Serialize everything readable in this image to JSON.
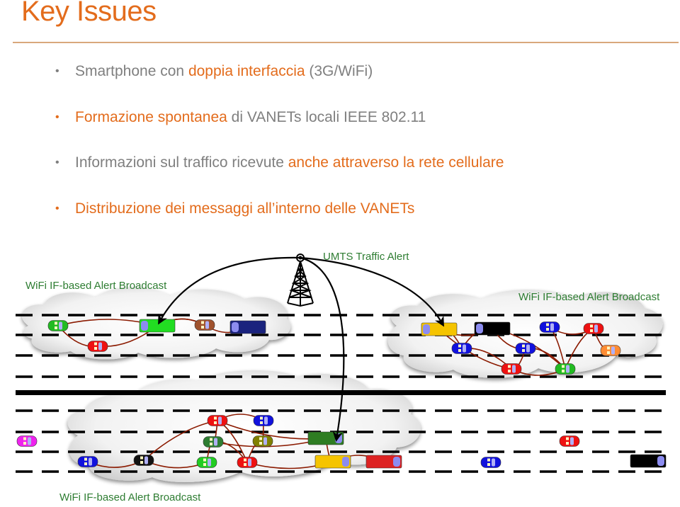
{
  "slide": {
    "title": "Key Issues",
    "accent_color": "#E36C1C",
    "text_color": "#7F7F7F",
    "bullets": [
      {
        "marker": "•",
        "marker_color": "gray",
        "parts": [
          {
            "text": "Smartphone con ",
            "highlight": false
          },
          {
            "text": "doppia interfaccia",
            "highlight": true
          },
          {
            "text": " (3G/WiFi)",
            "highlight": false
          }
        ]
      },
      {
        "marker": "•",
        "marker_color": "orange",
        "parts": [
          {
            "text": "Formazione spontanea",
            "highlight": true
          },
          {
            "text": " di VANETs locali IEEE 802.11",
            "highlight": false
          }
        ]
      },
      {
        "marker": "•",
        "marker_color": "gray",
        "parts": [
          {
            "text": "Informazioni sul traffico ricevute ",
            "highlight": false
          },
          {
            "text": "anche attraverso la rete cellulare",
            "highlight": true
          }
        ]
      },
      {
        "marker": "•",
        "marker_color": "orange",
        "parts": [
          {
            "text": "Distribuzione dei messaggi all’interno delle VANETs",
            "highlight": true
          }
        ]
      }
    ]
  },
  "diagram": {
    "label_color": "#2E7D32",
    "link_color": "#8B1A00",
    "labels": {
      "umts": "UMTS Traffic Alert",
      "wifi_left": "WiFi IF-based Alert Broadcast",
      "wifi_right": "WiFi IF-based Alert Broadcast",
      "wifi_bottom": "WiFi IF-based Alert Broadcast"
    },
    "icons": {
      "tower": "cell-tower-icon",
      "car": "car-icon",
      "truck": "truck-icon",
      "cloud": "wifi-cloud"
    },
    "vehicles": [
      {
        "group": "left",
        "type": "car",
        "color": "#22BB22",
        "dir": "right"
      },
      {
        "group": "left",
        "type": "car",
        "color": "#EE1111",
        "dir": "right"
      },
      {
        "group": "left",
        "type": "truck",
        "color": "#22DD22",
        "dir": "left"
      },
      {
        "group": "left",
        "type": "car",
        "color": "#A0522D",
        "dir": "right"
      },
      {
        "group": "left",
        "type": "truck",
        "color": "#1A237E",
        "dir": "left"
      },
      {
        "group": "right",
        "type": "truck",
        "color": "#F5C400",
        "dir": "left"
      },
      {
        "group": "right",
        "type": "truck",
        "color": "#000000",
        "dir": "left"
      },
      {
        "group": "right",
        "type": "car",
        "color": "#1111DD",
        "dir": "right"
      },
      {
        "group": "right",
        "type": "car",
        "color": "#EE1111",
        "dir": "right"
      },
      {
        "group": "right",
        "type": "car",
        "color": "#1111DD",
        "dir": "right"
      },
      {
        "group": "right",
        "type": "car",
        "color": "#1111DD",
        "dir": "right"
      },
      {
        "group": "right",
        "type": "car",
        "color": "#FF8C33",
        "dir": "right"
      },
      {
        "group": "right",
        "type": "car",
        "color": "#EE1111",
        "dir": "right"
      },
      {
        "group": "right",
        "type": "car",
        "color": "#22BB22",
        "dir": "right"
      },
      {
        "group": "bottom",
        "type": "car",
        "color": "#EE22EE",
        "dir": "right"
      },
      {
        "group": "bottom",
        "type": "car",
        "color": "#1111DD",
        "dir": "right"
      },
      {
        "group": "bottom",
        "type": "car",
        "color": "#111111",
        "dir": "right"
      },
      {
        "group": "bottom",
        "type": "car",
        "color": "#EE1111",
        "dir": "right"
      },
      {
        "group": "bottom",
        "type": "car",
        "color": "#1111DD",
        "dir": "right"
      },
      {
        "group": "bottom",
        "type": "car",
        "color": "#2E7D32",
        "dir": "right"
      },
      {
        "group": "bottom",
        "type": "car",
        "color": "#808000",
        "dir": "right"
      },
      {
        "group": "bottom",
        "type": "car",
        "color": "#22CC22",
        "dir": "right"
      },
      {
        "group": "bottom",
        "type": "car",
        "color": "#EE1111",
        "dir": "right"
      },
      {
        "group": "bottom",
        "type": "truck",
        "color": "#2E7D22",
        "dir": "right"
      },
      {
        "group": "bottom",
        "type": "truck",
        "color": "#F5C400",
        "dir": "right"
      },
      {
        "group": "bottom",
        "type": "truck",
        "color": "#DD2222",
        "dir": "right"
      },
      {
        "group": "outside",
        "type": "car",
        "color": "#1111DD",
        "dir": "right"
      },
      {
        "group": "outside",
        "type": "car",
        "color": "#EE1111",
        "dir": "right"
      },
      {
        "group": "outside",
        "type": "truck",
        "color": "#000000",
        "dir": "right"
      }
    ]
  }
}
